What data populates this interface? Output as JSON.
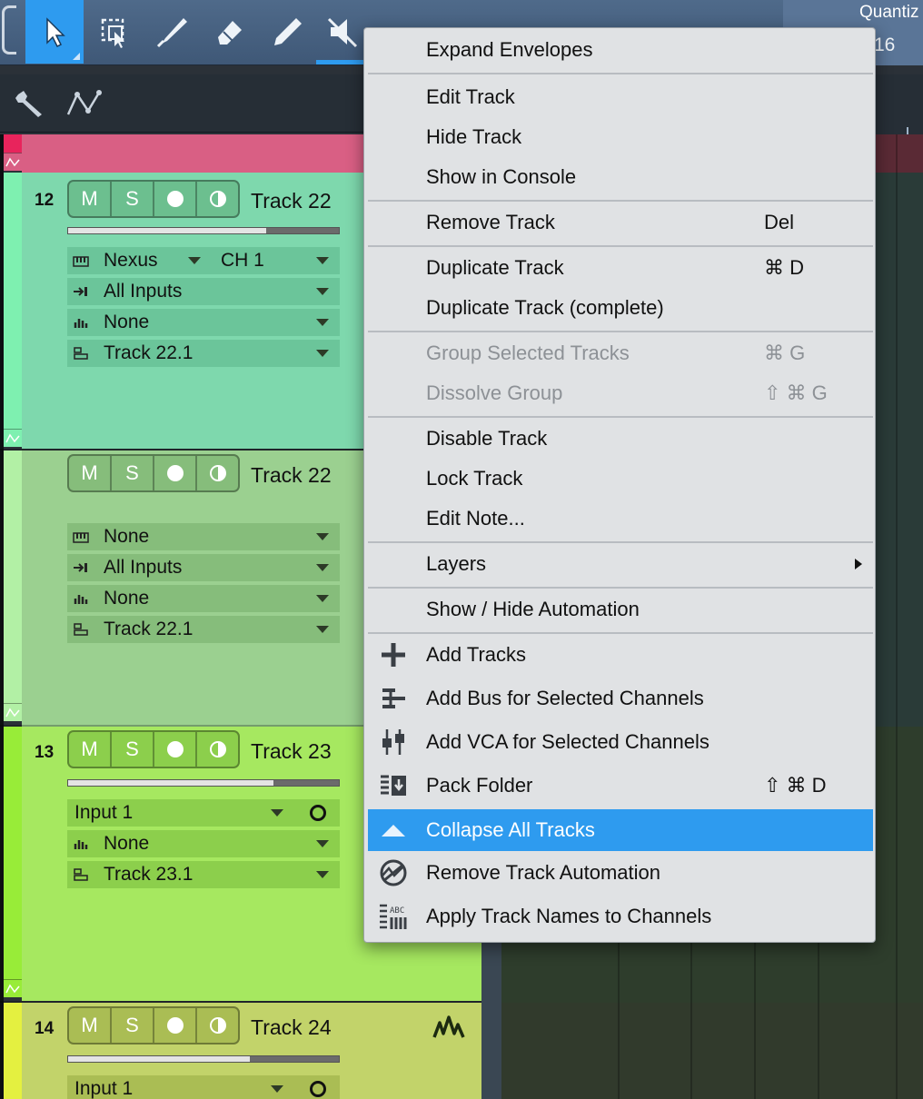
{
  "toolbar": {
    "tools": [
      {
        "icon": "arrow-pointer-icon",
        "active": true
      },
      {
        "icon": "range-select-icon"
      },
      {
        "icon": "split-knife-icon"
      },
      {
        "icon": "eraser-icon"
      },
      {
        "icon": "pencil-icon"
      },
      {
        "icon": "mute-speaker-icon"
      },
      {
        "icon": "listen-icon"
      },
      {
        "icon": "bend-icon"
      }
    ],
    "quantize_label": "Quantiz",
    "quantize_value": "16"
  },
  "track_tools": {
    "icons": [
      "wrench-icon",
      "automation-envelope-icon"
    ]
  },
  "colors": {
    "accent": "#2e9bef",
    "track22_header": "#7ed8ad",
    "track22_layer": "#9bd090",
    "track23": "#a6e860",
    "track24": "#c2d36a",
    "pink_folder": "#d95f84"
  },
  "tracks": [
    {
      "number": "12",
      "buttons": {
        "mute": "M",
        "solo": "S"
      },
      "name": "Track 22",
      "fader_level": 0.73,
      "rows": [
        {
          "icon": "keyboard-icon",
          "label": "Nexus",
          "extra": "CH 1"
        },
        {
          "icon": "input-arrow-icon",
          "label": "All Inputs"
        },
        {
          "icon": "meter-icon",
          "label": "None"
        },
        {
          "icon": "output-icon",
          "label": "Track 22.1"
        }
      ]
    },
    {
      "number": "",
      "buttons": {
        "mute": "M",
        "solo": "S"
      },
      "name": "Track 22",
      "rows": [
        {
          "icon": "keyboard-icon",
          "label": "None"
        },
        {
          "icon": "input-arrow-icon",
          "label": "All Inputs"
        },
        {
          "icon": "meter-icon",
          "label": "None"
        },
        {
          "icon": "output-icon",
          "label": "Track 22.1"
        }
      ]
    },
    {
      "number": "13",
      "buttons": {
        "mute": "M",
        "solo": "S"
      },
      "name": "Track 23",
      "fader_level": 0.76,
      "rows": [
        {
          "label": "Input 1"
        },
        {
          "icon": "meter-icon",
          "label": "None"
        },
        {
          "icon": "output-icon",
          "label": "Track 23.1"
        }
      ]
    },
    {
      "number": "14",
      "buttons": {
        "mute": "M",
        "solo": "S"
      },
      "name": "Track 24",
      "fader_level": 0.67,
      "rows": [
        {
          "label": "Input 1"
        }
      ]
    }
  ],
  "context_menu": {
    "items": [
      {
        "label": "Expand Envelopes"
      },
      {
        "label": "Edit Track"
      },
      {
        "label": "Hide Track"
      },
      {
        "label": "Show in Console"
      },
      {
        "label": "Remove Track",
        "shortcut": "Del"
      },
      {
        "label": "Duplicate Track",
        "shortcut": "⌘ D"
      },
      {
        "label": "Duplicate Track (complete)"
      },
      {
        "label": "Group Selected Tracks",
        "shortcut": "⌘ G",
        "disabled": true
      },
      {
        "label": "Dissolve Group",
        "shortcut": "⇧ ⌘ G",
        "disabled": true
      },
      {
        "label": "Disable Track"
      },
      {
        "label": "Lock Track"
      },
      {
        "label": "Edit Note..."
      },
      {
        "label": "Layers",
        "submenu": true
      },
      {
        "label": "Show / Hide Automation"
      },
      {
        "label": "Add Tracks",
        "icon": "plus-icon"
      },
      {
        "label": "Add Bus for Selected Channels",
        "icon": "bus-icon"
      },
      {
        "label": "Add VCA for Selected Channels",
        "icon": "vca-icon"
      },
      {
        "label": "Pack Folder",
        "shortcut": "⇧ ⌘ D",
        "icon": "pack-folder-icon"
      },
      {
        "label": "Collapse All Tracks",
        "icon": "collapse-triangle-icon",
        "highlighted": true
      },
      {
        "label": "Remove Track Automation",
        "icon": "remove-automation-icon"
      },
      {
        "label": "Apply Track Names to Channels",
        "icon": "track-names-icon"
      }
    ]
  }
}
